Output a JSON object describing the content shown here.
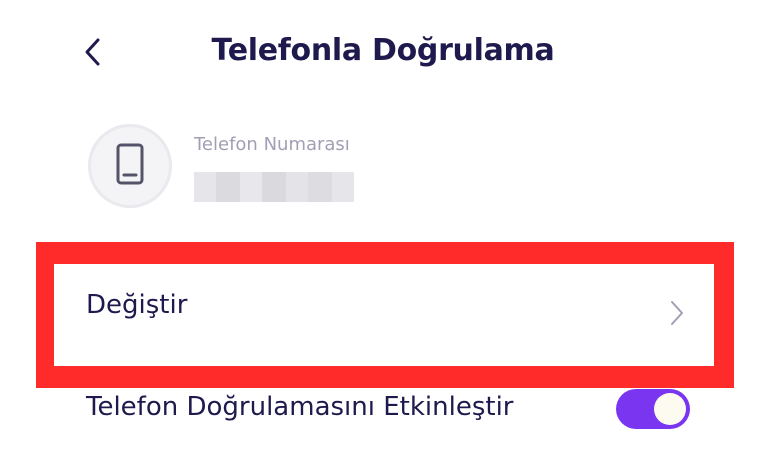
{
  "header": {
    "title": "Telefonla Doğrulama",
    "back_icon": "chevron-left-icon"
  },
  "phone": {
    "icon": "smartphone-icon",
    "label": "Telefon Numarası",
    "value_state": "blurred"
  },
  "change_row": {
    "label": "Değiştir",
    "icon": "chevron-right-icon"
  },
  "toggle_row": {
    "label": "Telefon Doğrulamasını Etkinleştir",
    "enabled": true
  },
  "colors": {
    "primary_text": "#1e1a4d",
    "secondary_text": "#a19fb4",
    "toggle_on": "#7a35f0",
    "highlight": "#ff2b2b"
  }
}
